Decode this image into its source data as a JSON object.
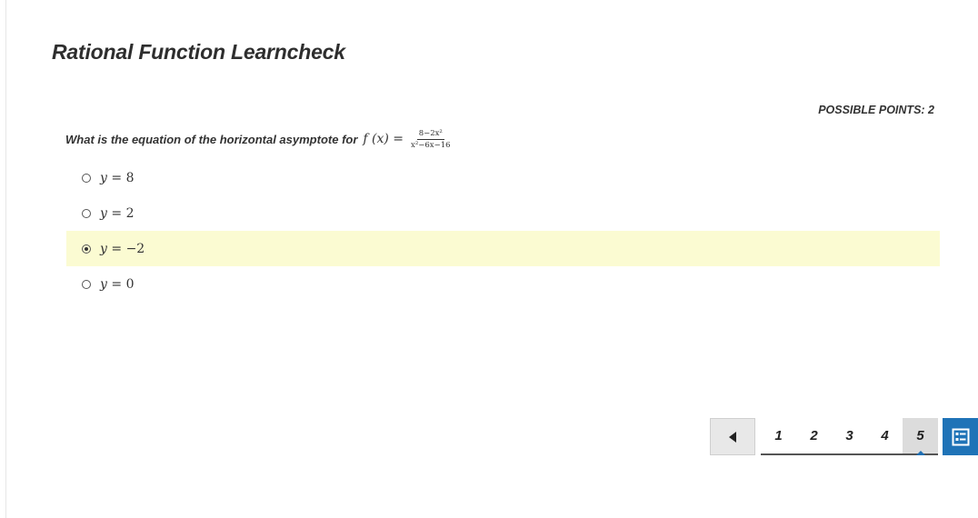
{
  "title": "Rational Function Learncheck",
  "possible_points": "POSSIBLE POINTS: 2",
  "question": {
    "prompt": "What is the equation of the horizontal asymptote for",
    "function": "f (x) =",
    "numerator": "8−2x²",
    "denominator": "x²−6x−16"
  },
  "choices": [
    {
      "var": "y",
      "eq": " = ",
      "value": "8",
      "selected": false
    },
    {
      "var": "y",
      "eq": " = ",
      "value": "2",
      "selected": false
    },
    {
      "var": "y",
      "eq": " = ",
      "value": "−2",
      "selected": true
    },
    {
      "var": "y",
      "eq": " = ",
      "value": "0",
      "selected": false
    }
  ],
  "pagination": {
    "pages": [
      "1",
      "2",
      "3",
      "4",
      "5"
    ],
    "current": "5"
  },
  "icons": {
    "prev": "triangle-left-icon",
    "question-list": "question-list-icon"
  },
  "colors": {
    "selected_highlight": "#fbfbd2",
    "accent": "#1f73b7"
  }
}
